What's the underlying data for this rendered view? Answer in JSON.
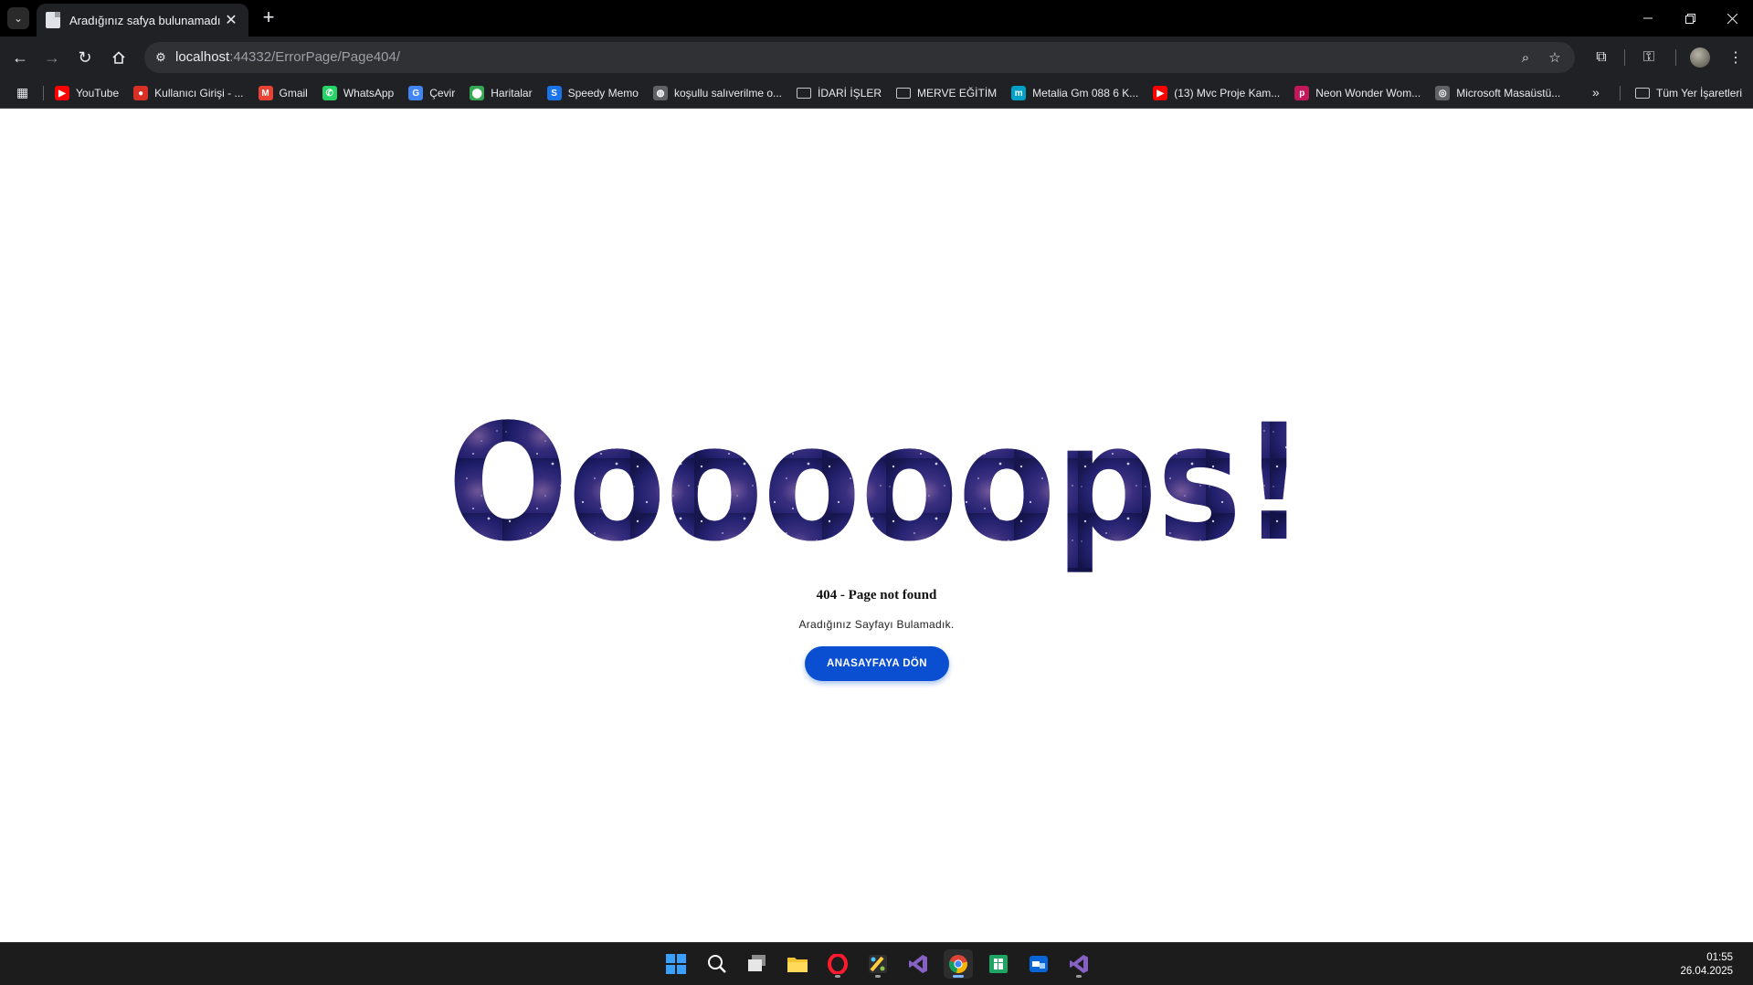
{
  "browser": {
    "tab_title": "Aradığınız safya bulunamadı",
    "tab_close": "✕",
    "new_tab": "+",
    "url_host": "localhost",
    "url_path": ":44332/ErrorPage/Page404/"
  },
  "bookmarks": [
    {
      "label": "YouTube",
      "icon": "youtube-icon",
      "color": "#ff0000",
      "glyph": "▶"
    },
    {
      "label": "Kullanıcı Girişi - ...",
      "icon": "login-icon",
      "color": "#d93025",
      "glyph": "●"
    },
    {
      "label": "Gmail",
      "icon": "gmail-icon",
      "color": "#ea4335",
      "glyph": "M"
    },
    {
      "label": "WhatsApp",
      "icon": "whatsapp-icon",
      "color": "#25d366",
      "glyph": "✆"
    },
    {
      "label": "Çevir",
      "icon": "translate-icon",
      "color": "#4285f4",
      "glyph": "G"
    },
    {
      "label": "Haritalar",
      "icon": "maps-icon",
      "color": "#34a853",
      "glyph": "⬤"
    },
    {
      "label": "Speedy Memo",
      "icon": "speedy-memo-icon",
      "color": "#1a73e8",
      "glyph": "S"
    },
    {
      "label": "koşullu salıverilme o...",
      "icon": "globe-icon",
      "color": "#5f6368",
      "glyph": "◍"
    },
    {
      "label": "İDARİ İŞLER",
      "icon": "folder-icon",
      "color": "",
      "glyph": ""
    },
    {
      "label": "MERVE EĞİTİM",
      "icon": "folder-icon",
      "color": "",
      "glyph": ""
    },
    {
      "label": "Metalia Gm 088 6 K...",
      "icon": "metalia-icon",
      "color": "#00a0c8",
      "glyph": "m"
    },
    {
      "label": "(13) Mvc Proje Kam...",
      "icon": "youtube-icon",
      "color": "#ff0000",
      "glyph": "▶"
    },
    {
      "label": "Neon Wonder Wom...",
      "icon": "png-icon",
      "color": "#c2185b",
      "glyph": "p"
    },
    {
      "label": "Microsoft Masaüstü...",
      "icon": "microsoft-icon",
      "color": "#5f6368",
      "glyph": "◎"
    }
  ],
  "bookmarks_more": "»",
  "all_bookmarks": "Tüm Yer İşaretleri",
  "page": {
    "oops_text": "Oooooops!",
    "error_title": "404 - Page not found",
    "error_subtitle": "Aradığınız Sayfayı Bulamadık.",
    "home_button": "ANASAYFAYA DÖN",
    "button_color": "#0a4fd1"
  },
  "taskbar": {
    "apps": [
      {
        "name": "windows-start-icon",
        "active": false
      },
      {
        "name": "search-icon",
        "active": false
      },
      {
        "name": "task-view-icon",
        "active": false
      },
      {
        "name": "file-explorer-icon",
        "active": false
      },
      {
        "name": "opera-icon",
        "active": false,
        "running": true
      },
      {
        "name": "paint-icon",
        "active": false,
        "running": true
      },
      {
        "name": "visual-studio-icon",
        "active": false
      },
      {
        "name": "chrome-icon",
        "active": true,
        "running": true
      },
      {
        "name": "sheets-icon",
        "active": false
      },
      {
        "name": "remote-desktop-icon",
        "active": false
      },
      {
        "name": "visual-studio-2-icon",
        "active": false,
        "running": true
      }
    ],
    "time": "01:55",
    "date": "26.04.2025"
  }
}
